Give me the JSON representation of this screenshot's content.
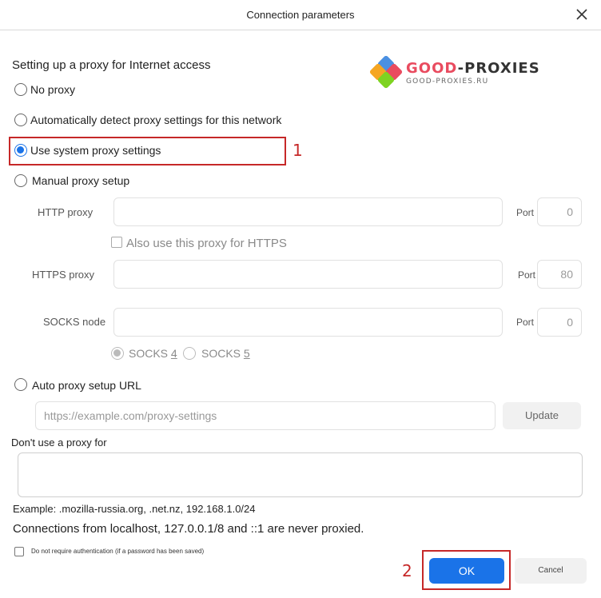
{
  "window": {
    "title": "Connection parameters"
  },
  "logo": {
    "word_part1": "GOOD",
    "word_part2": "-PROXIES",
    "domain": "GOOD-PROXIES.RU"
  },
  "section": {
    "heading": "Setting up a proxy for Internet access"
  },
  "options": {
    "no_proxy": "No proxy",
    "auto_detect": "Automatically detect proxy settings for this network",
    "system": "Use system proxy settings",
    "manual": "Manual proxy setup",
    "auto_url": "Auto proxy setup URL"
  },
  "selected_option": "system",
  "manual": {
    "http_label": "HTTP proxy",
    "http_value": "",
    "http_port_label": "Port",
    "http_port_value": "0",
    "also_https_label": "Also use this proxy for HTTPS",
    "https_label": "HTTPS proxy",
    "https_value": "",
    "https_port_label": "Port",
    "https_port_value": "80",
    "socks_label": "SOCKS node",
    "socks_value": "",
    "socks_port_label": "Port",
    "socks_port_value": "0",
    "socks4_label": "SOCKS",
    "socks4_num": "4",
    "socks5_label": "SOCKS",
    "socks5_num": "5"
  },
  "auto_url": {
    "placeholder": "https://example.com/proxy-settings",
    "update_label": "Update"
  },
  "no_proxy_for": {
    "label": "Don't use a proxy for",
    "value": "",
    "example": "Example: .mozilla-russia.org, .net.nz, 192.168.1.0/24",
    "note": "Connections from localhost, 127.0.0.1/8 and ::1 are never proxied."
  },
  "auth": {
    "label": "Do not require authentication (if a password has been saved)"
  },
  "buttons": {
    "ok": "OK",
    "cancel": "Cancel"
  },
  "annotations": {
    "marker1": "1",
    "marker2": "2"
  },
  "colors": {
    "accent": "#1a73e8",
    "highlight": "#c62828"
  }
}
